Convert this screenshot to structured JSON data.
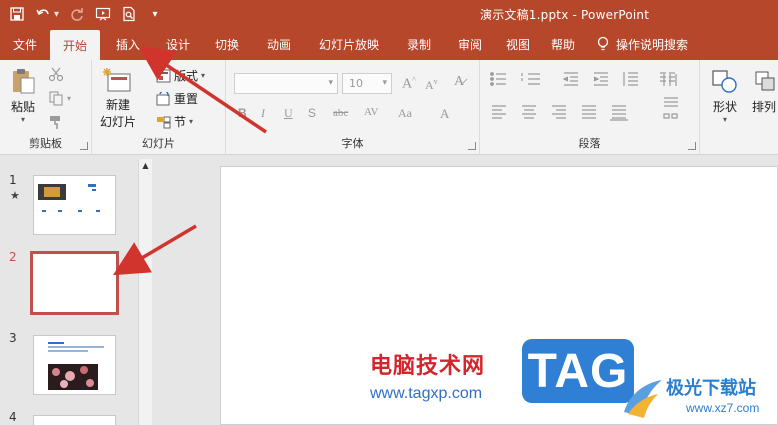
{
  "window": {
    "title": "演示文稿1.pptx  -  PowerPoint"
  },
  "qat": {
    "more_label": "▾"
  },
  "tabs": [
    {
      "label": "文件"
    },
    {
      "label": "开始"
    },
    {
      "label": "插入"
    },
    {
      "label": "设计"
    },
    {
      "label": "切换"
    },
    {
      "label": "动画"
    },
    {
      "label": "幻灯片放映"
    },
    {
      "label": "录制"
    },
    {
      "label": "审阅"
    },
    {
      "label": "视图"
    },
    {
      "label": "帮助"
    }
  ],
  "tell_me": {
    "label": "操作说明搜索"
  },
  "ribbon": {
    "clipboard": {
      "group_label": "剪贴板",
      "paste_label": "粘贴"
    },
    "slides": {
      "group_label": "幻灯片",
      "new_slide_line1": "新建",
      "new_slide_line2": "幻灯片",
      "layout_label": "版式",
      "reset_label": "重置",
      "section_label": "节"
    },
    "font": {
      "group_label": "字体",
      "font_size_value": "10",
      "bold": "B",
      "italic": "I",
      "underline": "U",
      "strike": "S",
      "abc": "abc",
      "spacing": "AV",
      "case": "Aa",
      "color": "A"
    },
    "paragraph": {
      "group_label": "段落"
    },
    "drawing": {
      "shapes_label": "形状",
      "arrange_label": "排列"
    }
  },
  "slides": [
    {
      "number": "1",
      "marker": "★"
    },
    {
      "number": "2"
    },
    {
      "number": "3"
    },
    {
      "number": "4"
    }
  ],
  "watermark": {
    "site_cn": "电脑技术网",
    "site_url": "www.tagxp.com",
    "badge": "TAG",
    "site2_cn": "极光下载站",
    "site2_url": "www.xz7.com"
  },
  "colors": {
    "accent": "#b7472a",
    "selection": "#c0504d",
    "arrow": "#d0342c"
  }
}
